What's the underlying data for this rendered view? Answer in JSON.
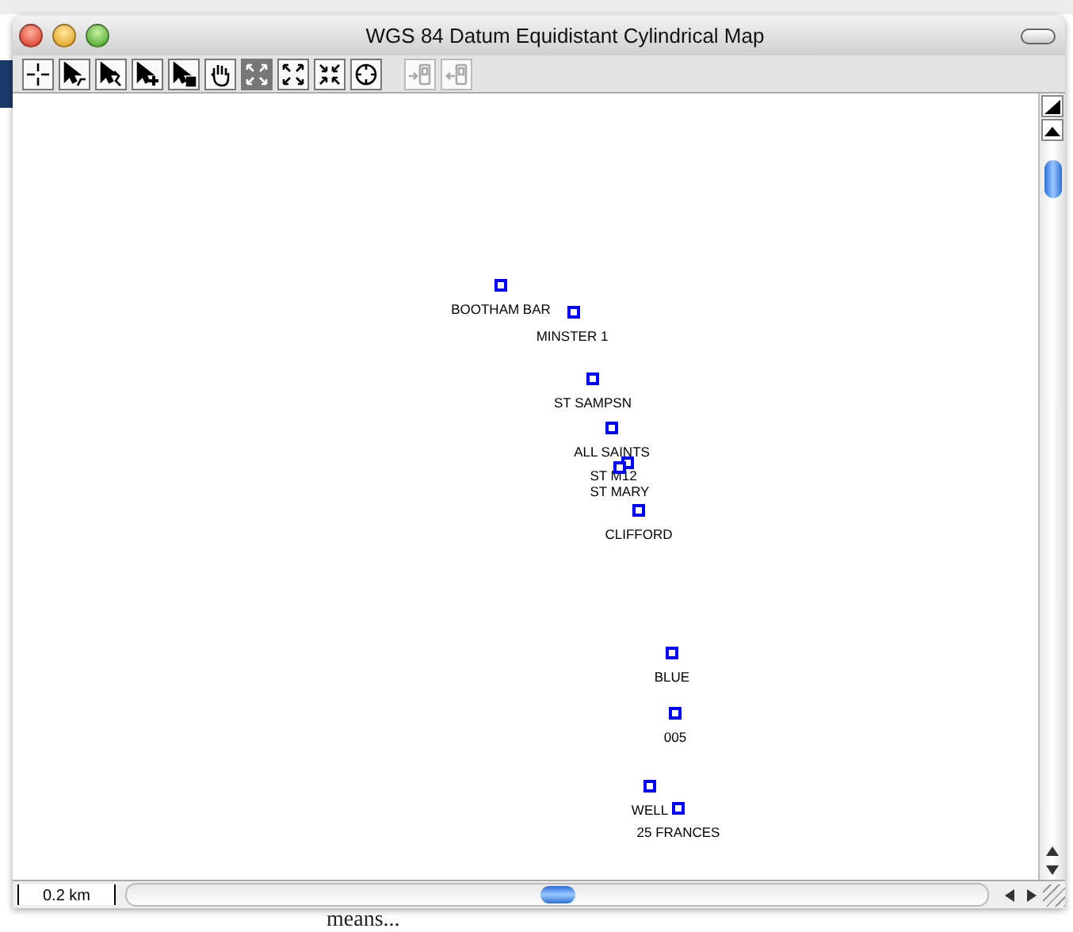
{
  "window": {
    "title": "WGS 84 Datum Equidistant Cylindrical Map"
  },
  "toolbar": {
    "tools": [
      {
        "kind": "crosshair",
        "selected": false,
        "disabled": false
      },
      {
        "kind": "route",
        "selected": false,
        "disabled": false
      },
      {
        "kind": "track",
        "selected": false,
        "disabled": false
      },
      {
        "kind": "add",
        "selected": false,
        "disabled": false
      },
      {
        "kind": "select",
        "selected": false,
        "disabled": false
      },
      {
        "kind": "hand",
        "selected": false,
        "disabled": false
      },
      {
        "kind": "fit",
        "selected": true,
        "disabled": false
      },
      {
        "kind": "expand",
        "selected": false,
        "disabled": false
      },
      {
        "kind": "shrink",
        "selected": false,
        "disabled": false
      },
      {
        "kind": "target",
        "selected": false,
        "disabled": false
      },
      {
        "kind": "send",
        "selected": false,
        "disabled": true
      },
      {
        "kind": "receive",
        "selected": false,
        "disabled": true
      }
    ]
  },
  "map": {
    "waypoints": [
      {
        "name": "BOOTHAM BAR"
      },
      {
        "name": "MINSTER 1"
      },
      {
        "name": "ST  SAMPSN"
      },
      {
        "name": "ALL SAINTS"
      },
      {
        "name": "ST M12"
      },
      {
        "name": "ST MARY"
      },
      {
        "name": "CLIFFORD"
      },
      {
        "name": "BLUE"
      },
      {
        "name": "005"
      },
      {
        "name": "WELL"
      },
      {
        "name": "25 FRANCES"
      }
    ],
    "scale": "0.2 km"
  },
  "background_text": "means..."
}
